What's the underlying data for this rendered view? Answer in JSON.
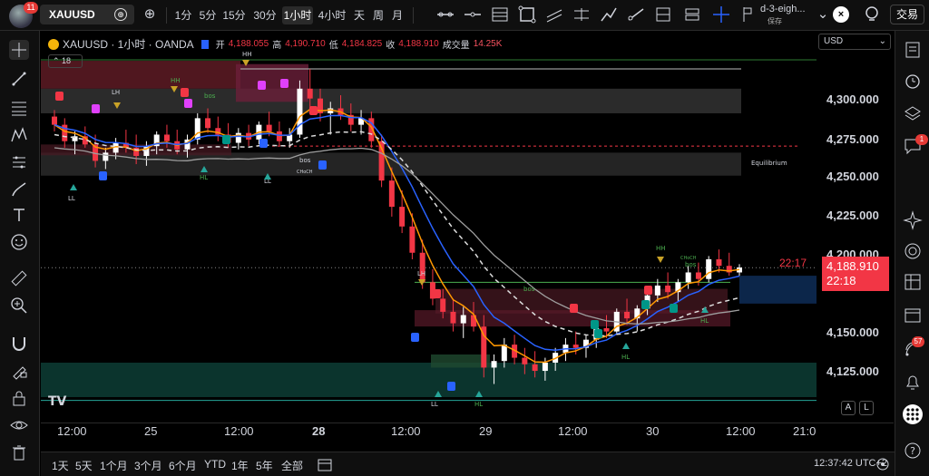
{
  "topbar": {
    "avatar_badge": "11",
    "symbol": "XAUUSD",
    "timeframes": [
      {
        "label": "1分",
        "active": false
      },
      {
        "label": "5分",
        "active": false
      },
      {
        "label": "15分",
        "active": false
      },
      {
        "label": "30分",
        "active": false
      },
      {
        "label": "1小时",
        "active": true
      },
      {
        "label": "4小时",
        "active": false
      },
      {
        "label": "天",
        "active": false
      },
      {
        "label": "周",
        "active": false
      },
      {
        "label": "月",
        "active": false
      }
    ],
    "layout_name": "d-3-eigh...",
    "layout_status": "保存",
    "trade_label": "交易"
  },
  "legend": {
    "title": "XAUUSD · 1小时 · OANDA",
    "open_label": "开",
    "open": "4,188.055",
    "high_label": "高",
    "high": "4,190.710",
    "low_label": "低",
    "low": "4,184.825",
    "close_label": "收",
    "close": "4,188.910",
    "volume_label": "成交量",
    "volume": "14.25K",
    "indicators_count": "18"
  },
  "price_axis": {
    "currency": "USD",
    "ticks": [
      "4,300.000",
      "4,275.000",
      "4,250.000",
      "4,225.000",
      "4,200.000",
      "4,150.000",
      "4,125.000"
    ],
    "current_price": "4,188.910",
    "current_time_label": "22:18",
    "countdown": "22:17"
  },
  "time_axis": {
    "ticks": [
      {
        "label": "12:00",
        "bold": false
      },
      {
        "label": "25",
        "bold": false
      },
      {
        "label": "12:00",
        "bold": false
      },
      {
        "label": "28",
        "bold": true
      },
      {
        "label": "12:00",
        "bold": false
      },
      {
        "label": "29",
        "bold": false
      },
      {
        "label": "12:00",
        "bold": false
      },
      {
        "label": "30",
        "bold": false
      },
      {
        "label": "12:00",
        "bold": false
      },
      {
        "label": "21:0",
        "bold": false
      }
    ]
  },
  "chart_labels": {
    "equilibrium": "Equilibrium",
    "hh": "HH",
    "lh": "LH",
    "ll": "LL",
    "hl": "HL",
    "bos": "bos",
    "choch": "CHoCH"
  },
  "chart_data": {
    "type": "candlestick",
    "symbol": "XAUUSD",
    "interval": "1小时",
    "y_range": [
      4110,
      4320
    ],
    "candles": [
      [
        4281,
        4285,
        4272,
        4276
      ],
      [
        4276,
        4280,
        4262,
        4266
      ],
      [
        4266,
        4272,
        4258,
        4269
      ],
      [
        4269,
        4275,
        4262,
        4264
      ],
      [
        4264,
        4270,
        4250,
        4254
      ],
      [
        4254,
        4262,
        4249,
        4259
      ],
      [
        4259,
        4268,
        4255,
        4265
      ],
      [
        4265,
        4273,
        4259,
        4262
      ],
      [
        4262,
        4270,
        4252,
        4257
      ],
      [
        4257,
        4266,
        4251,
        4263
      ],
      [
        4263,
        4272,
        4258,
        4270
      ],
      [
        4270,
        4276,
        4262,
        4266
      ],
      [
        4266,
        4273,
        4258,
        4261
      ],
      [
        4261,
        4270,
        4256,
        4267
      ],
      [
        4267,
        4283,
        4264,
        4280
      ],
      [
        4280,
        4286,
        4271,
        4274
      ],
      [
        4274,
        4281,
        4266,
        4270
      ],
      [
        4270,
        4277,
        4262,
        4265
      ],
      [
        4265,
        4274,
        4261,
        4271
      ],
      [
        4271,
        4276,
        4263,
        4267
      ],
      [
        4267,
        4278,
        4264,
        4276
      ],
      [
        4276,
        4284,
        4269,
        4272
      ],
      [
        4272,
        4278,
        4263,
        4266
      ],
      [
        4266,
        4274,
        4262,
        4270
      ],
      [
        4270,
        4303,
        4268,
        4298
      ],
      [
        4298,
        4310,
        4286,
        4292
      ],
      [
        4292,
        4298,
        4278,
        4283
      ],
      [
        4283,
        4290,
        4270,
        4286
      ],
      [
        4286,
        4294,
        4279,
        4282
      ],
      [
        4282,
        4289,
        4272,
        4276
      ],
      [
        4276,
        4285,
        4270,
        4280
      ],
      [
        4280,
        4284,
        4262,
        4266
      ],
      [
        4266,
        4270,
        4238,
        4242
      ],
      [
        4242,
        4250,
        4220,
        4226
      ],
      [
        4226,
        4236,
        4210,
        4214
      ],
      [
        4214,
        4222,
        4194,
        4198
      ],
      [
        4198,
        4206,
        4176,
        4180
      ],
      [
        4180,
        4188,
        4166,
        4170
      ],
      [
        4170,
        4176,
        4158,
        4162
      ],
      [
        4162,
        4170,
        4150,
        4155
      ],
      [
        4155,
        4165,
        4146,
        4160
      ],
      [
        4160,
        4168,
        4150,
        4153
      ],
      [
        4153,
        4160,
        4122,
        4128
      ],
      [
        4128,
        4136,
        4118,
        4132
      ],
      [
        4132,
        4146,
        4128,
        4142
      ],
      [
        4142,
        4148,
        4130,
        4134
      ],
      [
        4134,
        4140,
        4124,
        4130
      ],
      [
        4130,
        4138,
        4122,
        4126
      ],
      [
        4126,
        4134,
        4120,
        4131
      ],
      [
        4131,
        4140,
        4126,
        4137
      ],
      [
        4137,
        4146,
        4132,
        4142
      ],
      [
        4142,
        4150,
        4136,
        4140
      ],
      [
        4140,
        4148,
        4134,
        4145
      ],
      [
        4145,
        4156,
        4140,
        4152
      ],
      [
        4152,
        4160,
        4146,
        4150
      ],
      [
        4150,
        4164,
        4148,
        4162
      ],
      [
        4162,
        4170,
        4154,
        4158
      ],
      [
        4158,
        4166,
        4150,
        4164
      ],
      [
        4164,
        4176,
        4160,
        4172
      ],
      [
        4172,
        4182,
        4168,
        4178
      ],
      [
        4178,
        4186,
        4170,
        4174
      ],
      [
        4174,
        4182,
        4168,
        4180
      ],
      [
        4180,
        4190,
        4176,
        4186
      ],
      [
        4186,
        4192,
        4178,
        4182
      ],
      [
        4182,
        4196,
        4180,
        4194
      ],
      [
        4194,
        4200,
        4186,
        4190
      ],
      [
        4190,
        4198,
        4184,
        4186
      ],
      [
        4186,
        4191,
        4184,
        4189
      ]
    ],
    "zones": [
      {
        "type": "supply",
        "top": 4315,
        "bottom": 4298
      },
      {
        "type": "premium",
        "top": 4298,
        "bottom": 4283
      },
      {
        "type": "equilibrium",
        "top": 4259,
        "bottom": 4245
      },
      {
        "type": "discount",
        "top": 4131,
        "bottom": 4110
      },
      {
        "type": "demand",
        "top": 4176,
        "bottom": 4161
      }
    ],
    "dashed_level": 4263,
    "current_price": 4188.91
  },
  "bottombar": {
    "ranges": [
      "1天",
      "5天",
      "1个月",
      "3个月",
      "6个月",
      "YTD",
      "1年",
      "5年",
      "全部"
    ],
    "clock": "12:37:42 UTC+2"
  },
  "rightbar": {
    "chat_badge": "1",
    "alerts_badge": "57"
  },
  "colors": {
    "up": "#ffffff",
    "down": "#f23645",
    "accent": "#2962ff",
    "orange_ma": "#ff9800",
    "blue_ma": "#2962ff",
    "grey_ma": "#9e9e9e"
  }
}
